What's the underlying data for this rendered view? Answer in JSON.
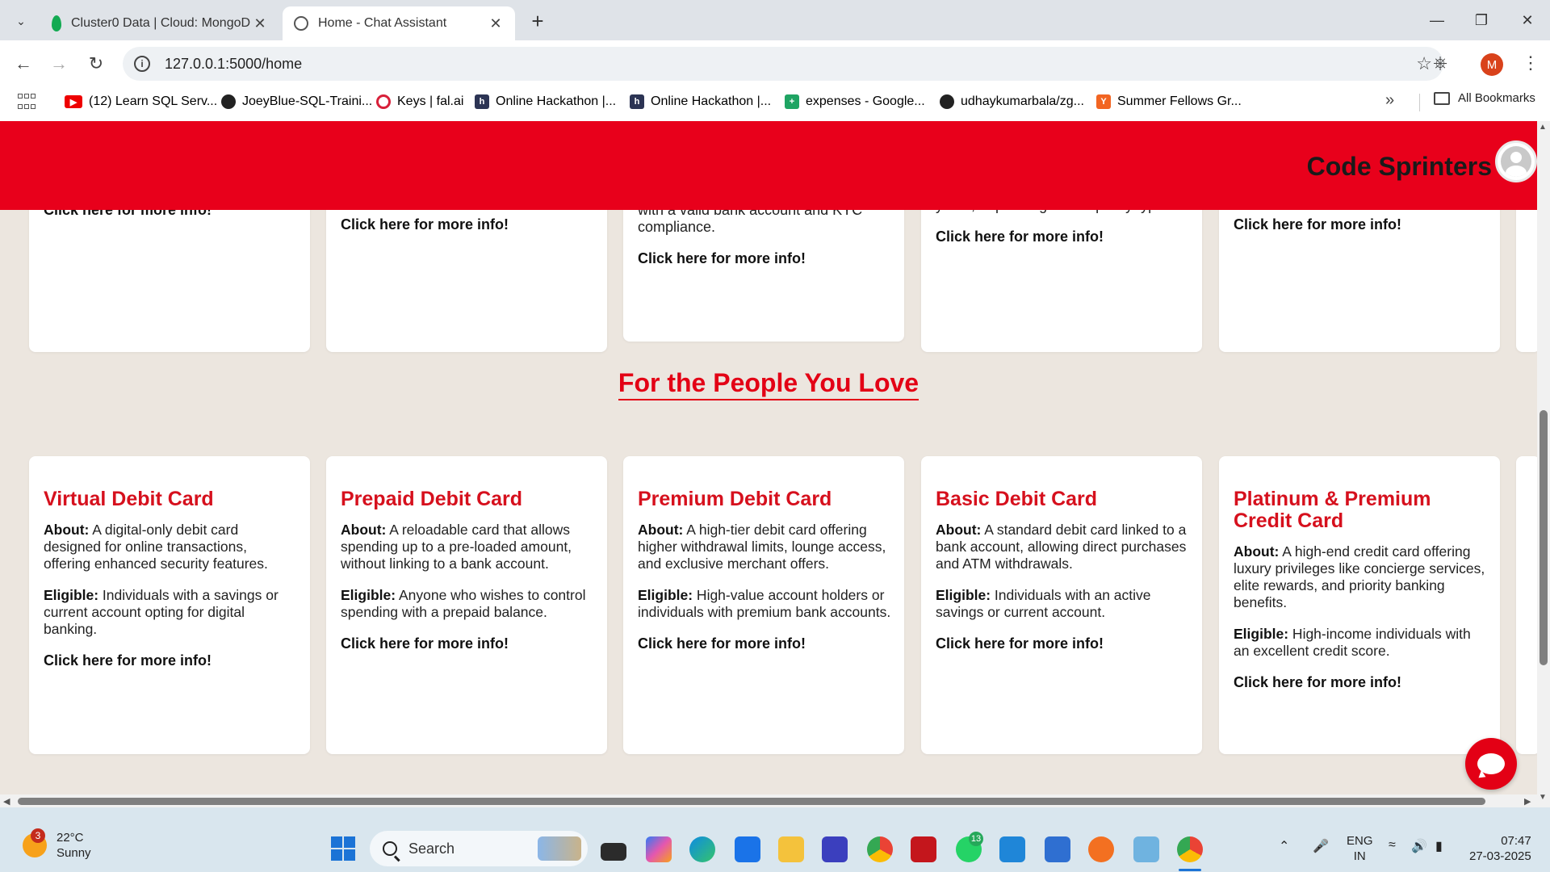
{
  "browser": {
    "tabs": [
      {
        "title": "Cluster0 Data | Cloud: MongoD",
        "active": false
      },
      {
        "title": "Home - Chat Assistant",
        "active": true
      }
    ],
    "url": "127.0.0.1:5000/home",
    "profile_initial": "M",
    "bookmarks": [
      {
        "label": "(12) Learn SQL Serv...",
        "icon": "youtube-icon"
      },
      {
        "label": "JoeyBlue-SQL-Traini...",
        "icon": "github-icon"
      },
      {
        "label": "Keys | fal.ai",
        "icon": "fal-icon"
      },
      {
        "label": "Online Hackathon |...",
        "icon": "hackerearth-icon"
      },
      {
        "label": "Online Hackathon |...",
        "icon": "hackerearth-icon"
      },
      {
        "label": "expenses - Google...",
        "icon": "sheets-icon"
      },
      {
        "label": "udhaykumarbala/zg...",
        "icon": "github-icon"
      },
      {
        "label": "Summer Fellows Gr...",
        "icon": "ycombinator-icon"
      }
    ],
    "all_bookmarks": "All Bookmarks"
  },
  "site": {
    "brand": "Code Sprinters",
    "accent": "#e8001b",
    "top_cards": [
      {
        "lines": [],
        "link": "Click here for more info!"
      },
      {
        "lines": [],
        "link": "Click here for more info!"
      },
      {
        "lines": [
          "with a valid bank account and KYC",
          "compliance."
        ],
        "link": "Click here for more info!"
      },
      {
        "lines": [
          "years, depending on the policy type."
        ],
        "link": "Click here for more info!"
      },
      {
        "lines": [],
        "link": "Click here for more info!"
      }
    ],
    "section_title": "For the People You Love",
    "cards": [
      {
        "title": "Virtual Debit Card",
        "about_label": "About:",
        "about": " A digital-only debit card designed for online transactions, offering enhanced security features.",
        "eligible_label": "Eligible:",
        "eligible": " Individuals with a savings or current account opting for digital banking.",
        "link": "Click here for more info!"
      },
      {
        "title": "Prepaid Debit Card",
        "about_label": "About:",
        "about": " A reloadable card that allows spending up to a pre-loaded amount, without linking to a bank account.",
        "eligible_label": "Eligible:",
        "eligible": " Anyone who wishes to control spending with a prepaid balance.",
        "link": "Click here for more info!"
      },
      {
        "title": "Premium Debit Card",
        "about_label": "About:",
        "about": " A high-tier debit card offering higher withdrawal limits, lounge access, and exclusive merchant offers.",
        "eligible_label": "Eligible:",
        "eligible": " High-value account holders or individuals with premium bank accounts.",
        "link": "Click here for more info!"
      },
      {
        "title": "Basic Debit Card",
        "about_label": "About:",
        "about": " A standard debit card linked to a bank account, allowing direct purchases and ATM withdrawals.",
        "eligible_label": "Eligible:",
        "eligible": " Individuals with an active savings or current account.",
        "link": "Click here for more info!"
      },
      {
        "title": "Platinum & Premium Credit Card",
        "about_label": "About:",
        "about": " A high-end credit card offering luxury privileges like concierge services, elite rewards, and priority banking benefits.",
        "eligible_label": "Eligible:",
        "eligible": " High-income individuals with an excellent credit score.",
        "link": "Click here for more info!"
      }
    ]
  },
  "taskbar": {
    "weather_temp": "22°C",
    "weather_desc": "Sunny",
    "weather_badge": "3",
    "search_label": "Search",
    "whatsapp_badge": "13",
    "lang_line1": "ENG",
    "lang_line2": "IN",
    "time": "07:47",
    "date": "27-03-2025"
  }
}
